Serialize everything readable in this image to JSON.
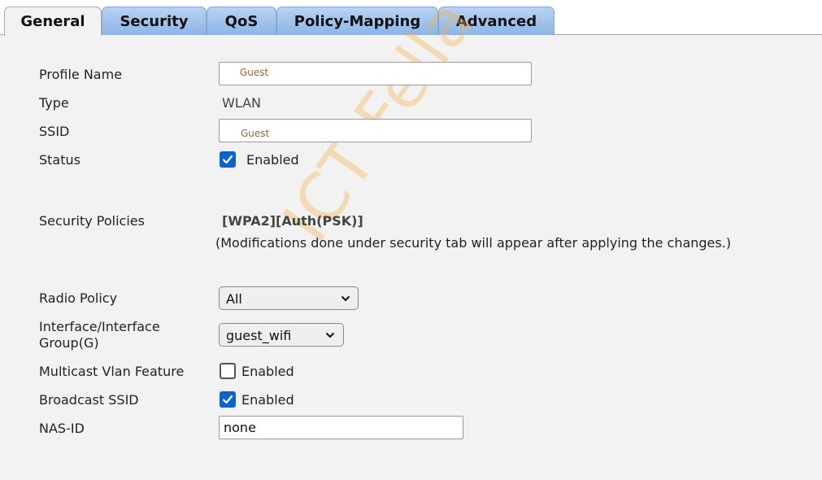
{
  "tabs": [
    {
      "label": "General",
      "active": true
    },
    {
      "label": "Security",
      "active": false
    },
    {
      "label": "QoS",
      "active": false
    },
    {
      "label": "Policy-Mapping",
      "active": false
    },
    {
      "label": "Advanced",
      "active": false
    }
  ],
  "form": {
    "profile_name": {
      "label": "Profile Name",
      "value": "Guest"
    },
    "type": {
      "label": "Type",
      "value": "WLAN"
    },
    "ssid": {
      "label": "SSID",
      "value": "Guest"
    },
    "status": {
      "label": "Status",
      "checkbox_label": "Enabled",
      "checked": true
    },
    "security_policies": {
      "label": "Security Policies",
      "value": "[WPA2][Auth(PSK)]",
      "note": "(Modifications done under security tab will appear after applying the changes.)"
    },
    "radio_policy": {
      "label": "Radio Policy",
      "selected": "All"
    },
    "interface": {
      "label_line1": "Interface/Interface",
      "label_line2": "Group(G)",
      "selected": "guest_wifi"
    },
    "multicast_vlan": {
      "label": "Multicast Vlan Feature",
      "checkbox_label": "Enabled",
      "checked": false
    },
    "broadcast_ssid": {
      "label": "Broadcast SSID",
      "checkbox_label": "Enabled",
      "checked": true
    },
    "nas_id": {
      "label": "NAS-ID",
      "value": "none"
    }
  },
  "watermark": "ICT Fella",
  "colors": {
    "accent": "#0b63d1",
    "tab": "#9fc2ee",
    "watermark": "#f5b041"
  }
}
